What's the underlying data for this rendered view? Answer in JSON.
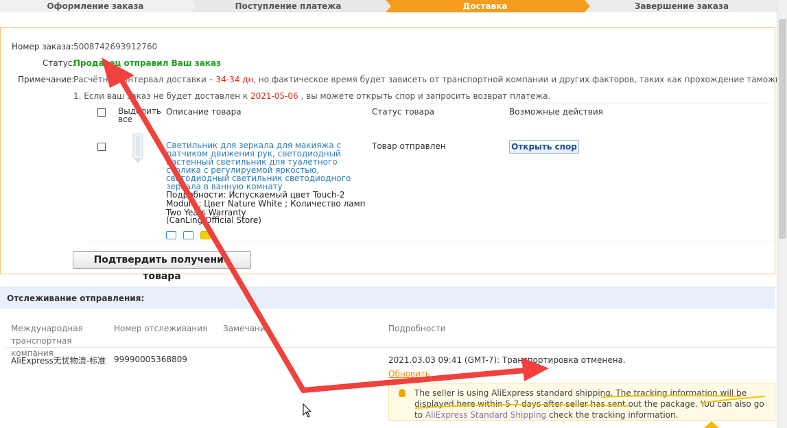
{
  "steps": [
    "Оформление заказа",
    "Поступление платежа",
    "Доставка",
    "Завершение заказа"
  ],
  "order": {
    "number_label": "Номер заказа:",
    "number": "5008742693912760",
    "status_label": "Статус:",
    "status": "Продавец отправил Ваш заказ",
    "note_label": "Примечание:",
    "note_prefix": "Расчётный интервал доставки –",
    "note_days": " 34-34 дн",
    "note_suffix": ", но фактическое время будет зависеть от транспортной компании и других факторов, таких как прохождение таможни.",
    "note2_prefix": "1. Если ваш заказ не будет доставлен к",
    "note2_date": " 2021-05-06 ",
    "note2_suffix": ", вы можете открыть спор и запросить возврат платежа."
  },
  "table": {
    "select_all": "Выделить все",
    "col_desc": "Описание товара",
    "col_status": "Статус товара",
    "col_actions": "Возможные действия"
  },
  "product": {
    "title": "Светильник для зеркала для макияжа с датчиком движения рук, светодиодный настенный светильник для туалетного столика с регулируемой яркостью, светодиодный светильник светодиодного зеркала в ванную комнату",
    "details": "Подробности: Испускаемый цвет Touch-2 Module ; Цвет Nature White ; Количество ламп Two Years Warranty",
    "store": "(CanLing Official Store)",
    "status": "Товар отправлен",
    "dispute_button": "Открыть спор"
  },
  "confirm_button": "Подтвердить получение товара",
  "tracking": {
    "header": "Отслеживание отправления:",
    "col_company": "Международная транспортная компания",
    "col_number": "Номер отслеживания",
    "col_remarks": "Замечания",
    "col_details": "Подробности",
    "company": "AliExpress无忧物流-标准",
    "number": "99990005368809",
    "event": "2021.03.03 09:41 (GMT-7): Транспортировка отменена.",
    "refresh": "Обновить",
    "info_1": "The seller is using AliExpress standard shipping. The tracking information will be displayed here within 5-7 days after seller has sent out the package. You can also go to ",
    "info_link": "AliExpress Standard Shipping",
    "info_2": " check the tracking information."
  },
  "colors": {
    "active_step": "#f59b1e",
    "status_green": "#1f9b1f",
    "red": "#e0231e",
    "link_blue": "#2a7dbf",
    "annotation_arrow": "#f0413c"
  }
}
